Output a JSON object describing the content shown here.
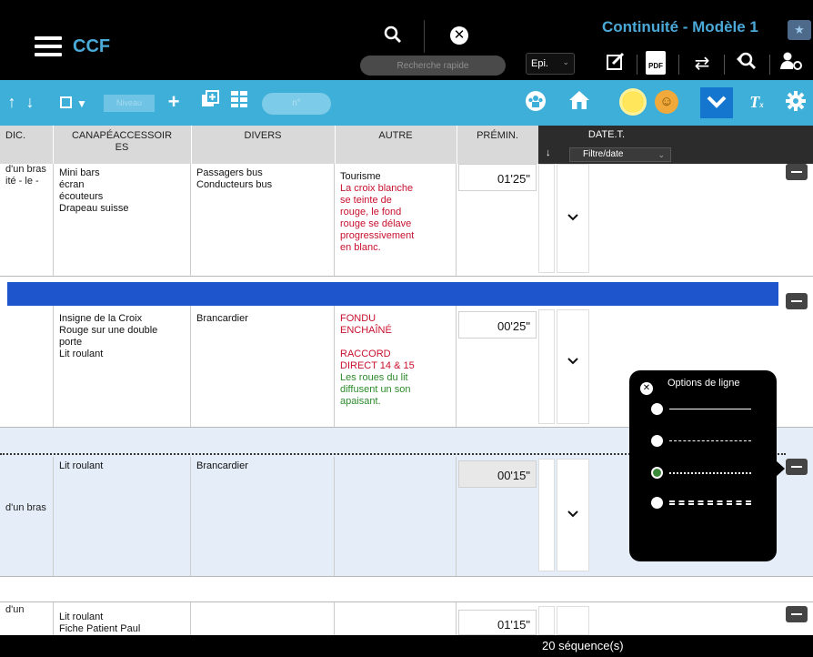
{
  "topbar": {
    "app_title": "CCF",
    "model_title": "Continuité - Modèle 1",
    "search_placeholder": "Recherche rapide",
    "epi_select": "Epi.",
    "pdf_label": "PDF"
  },
  "toolbar": {
    "niveau_placeholder": "Niveau",
    "number_placeholder": "n°"
  },
  "table": {
    "headers": {
      "col0": "DIC.",
      "canape_line1": "CANAPÉACCESSOIR",
      "canape_line2": "ES",
      "divers": "DIVERS",
      "autre": "AUTRE",
      "premin": "PRÉMIN.",
      "date": "DATE.T.",
      "date_filter": "Filtre/date"
    },
    "rows": [
      {
        "left_lines": [
          "d'un",
          "",
          "bras",
          "ité -",
          "",
          "",
          "",
          "le -"
        ],
        "accessoires": [
          "Mini bars",
          "écran",
          "écouteurs",
          "Drapeau suisse"
        ],
        "divers": [
          "Passagers bus",
          "Conducteurs bus"
        ],
        "autre_black": [
          "Tourisme"
        ],
        "autre_red": [
          "La croix blanche",
          "se teinte de",
          "rouge, le fond",
          "rouge se délave",
          "progressivement",
          "en blanc."
        ],
        "autre_green": [],
        "premin": "01'25\""
      },
      {
        "left_lines": [],
        "accessoires": [
          "Insigne de la Croix",
          "Rouge sur une double",
          "porte",
          "Lit roulant"
        ],
        "divers": [
          "Brancardier"
        ],
        "autre_black": [],
        "autre_red": [
          "FONDU",
          "ENCHAÎNÉ",
          "",
          "RACCORD",
          "DIRECT 14 & 15"
        ],
        "autre_green": [
          "Les roues du lit",
          "diffusent un son",
          "apaisant."
        ],
        "premin": "00'25\""
      },
      {
        "left_lines": [
          "",
          "",
          "",
          "d'un",
          "",
          "bras"
        ],
        "accessoires": [
          "Lit roulant"
        ],
        "divers": [
          "Brancardier"
        ],
        "autre_black": [],
        "autre_red": [],
        "autre_green": [],
        "premin": "00'15\""
      },
      {
        "left_lines": [
          "d'un"
        ],
        "accessoires": [
          "Lit roulant",
          "Fiche Patient Paul"
        ],
        "divers": [],
        "autre_black": [],
        "autre_red": [],
        "autre_green": [],
        "premin": "01'15\""
      }
    ]
  },
  "popup": {
    "title": "Options de ligne",
    "options": [
      "solid",
      "dashed",
      "dotted",
      "double"
    ],
    "selected": "dotted"
  },
  "footer": {
    "sequence_count": "20 séquence(s)"
  },
  "colors": {
    "accent_blue": "#3eafd8",
    "title_blue": "#4ba9d8",
    "selection_blue": "#1e55cc",
    "text_red": "#c8102e",
    "text_green": "#2c8a2c"
  },
  "icons": [
    "menu-icon",
    "search-icon",
    "close-circle-icon",
    "edit-icon",
    "pdf-icon",
    "swap-icon",
    "search-refresh-icon",
    "user-settings-icon",
    "star-icon",
    "arrow-up-icon",
    "arrow-down-icon",
    "checkbox-icon",
    "plus-icon",
    "copy-icon",
    "grid-icon",
    "group-icon",
    "home-icon",
    "sun-icon",
    "smiley-icon",
    "chevron-down-icon",
    "clear-format-icon",
    "gear-icon"
  ]
}
